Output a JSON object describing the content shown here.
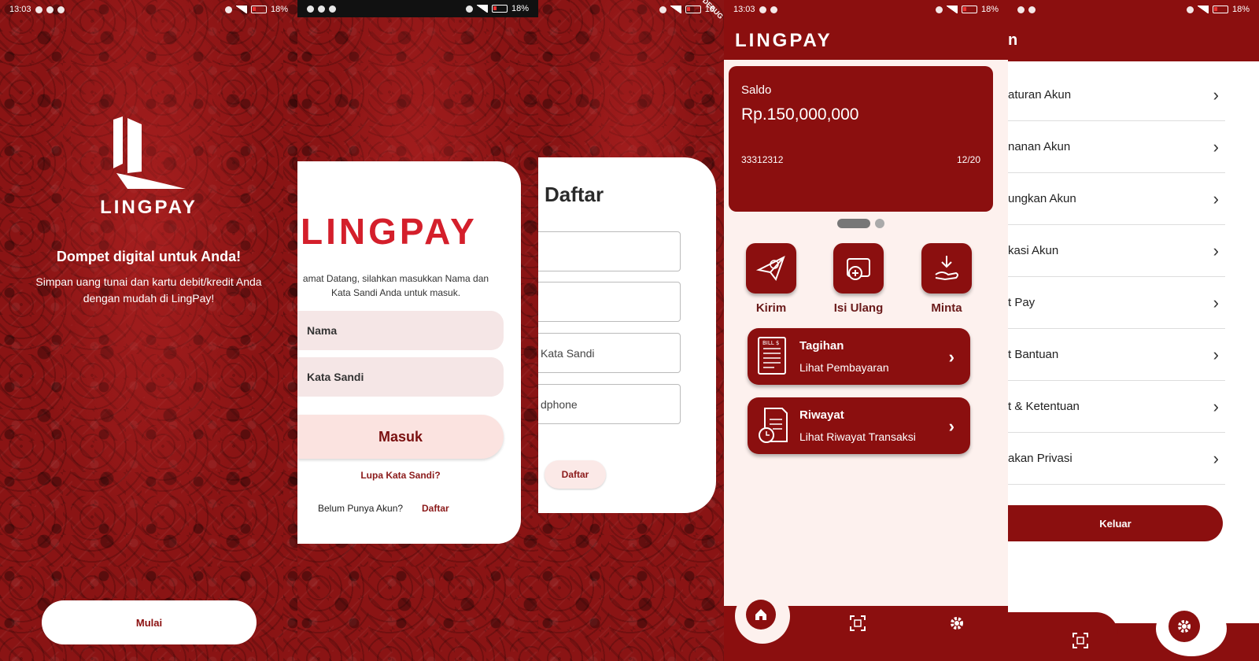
{
  "colors": {
    "brand": "#8b0f0f",
    "accent": "#d41f2b",
    "card_bg": "#fdf1ee"
  },
  "screen1": {
    "status_time": "13:03",
    "battery": "18%",
    "brand": "LINGPAY",
    "tagline": "Dompet digital untuk Anda!",
    "description": "Simpan uang tunai dan kartu debit/kredit Anda dengan mudah di LingPay!",
    "start_button": "Mulai"
  },
  "screen2": {
    "battery": "18%",
    "logo": "LINGPAY",
    "welcome": "amat Datang, silahkan masukkan Nama dan Kata Sandi Anda untuk masuk.",
    "name_placeholder": "Nama",
    "password_placeholder": "Kata Sandi",
    "login_button": "Masuk",
    "forgot": "Lupa Kata Sandi?",
    "no_account": "Belum Punya Akun?",
    "register_link": "Daftar"
  },
  "screen3": {
    "battery": "18",
    "debug": "DEBUG",
    "title": "Daftar",
    "fields": [
      "",
      "",
      "Kata Sandi",
      "dphone"
    ],
    "register_button": "Daftar"
  },
  "screen4": {
    "status_time": "13:03",
    "battery": "18%",
    "logo": "LINGPAY",
    "balance_label": "Saldo",
    "balance_value": "Rp.150,000,000",
    "account_number": "33312312",
    "expiry": "12/20",
    "actions": [
      {
        "label": "Kirim",
        "icon": "send-money-icon"
      },
      {
        "label": "Isi Ulang",
        "icon": "top-up-icon"
      },
      {
        "label": "Minta",
        "icon": "request-money-icon"
      }
    ],
    "menu": [
      {
        "title": "Tagihan",
        "subtitle": "Lihat Pembayaran",
        "icon": "bill-icon"
      },
      {
        "title": "Riwayat",
        "subtitle": "Lihat Riwayat Transaksi",
        "icon": "history-icon"
      }
    ],
    "nav": [
      "home-icon",
      "qr-scan-icon",
      "gear-icon"
    ]
  },
  "screen5": {
    "battery": "18%",
    "title": "n",
    "items": [
      "aturan Akun",
      "nanan Akun",
      "ungkan Akun",
      "kasi Akun",
      "t Pay",
      "t Bantuan",
      "t & Ketentuan",
      "akan Privasi"
    ],
    "logout": "Keluar"
  }
}
